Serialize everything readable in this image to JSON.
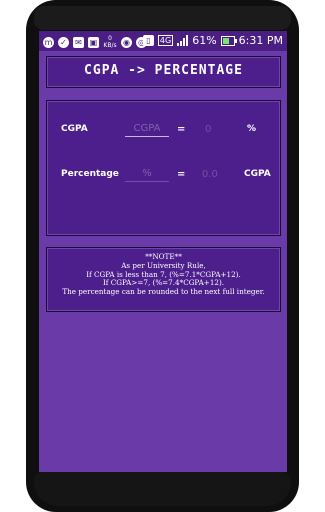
{
  "statusbar": {
    "left_icons": [
      "m-icon",
      "check-icon",
      "mail-icon",
      "hd-icon",
      "kbps-icon",
      "wifi-icon",
      "location-icon"
    ],
    "kbps_label": "0\nKB/s",
    "network_label": "4G",
    "battery_percent": "61%",
    "time": "6:31 PM"
  },
  "title": "CGPA -> PERCENTAGE",
  "calculator": {
    "row1": {
      "label": "CGPA",
      "input_placeholder": "CGPA",
      "equals": "=",
      "result": "0",
      "unit": "%"
    },
    "row2": {
      "label": "Percentage",
      "input_placeholder": "%",
      "equals": "=",
      "result": "0.0",
      "unit": "CGPA"
    }
  },
  "note": {
    "heading": "**NOTE**",
    "lines": [
      "As per University Rule,",
      "If CGPA is less than 7, (%=7.1*CGPA+12).",
      "If CGPA>=7, (%=7.4*CGPA+12).",
      "The percentage can be rounded to the next full integer."
    ]
  }
}
